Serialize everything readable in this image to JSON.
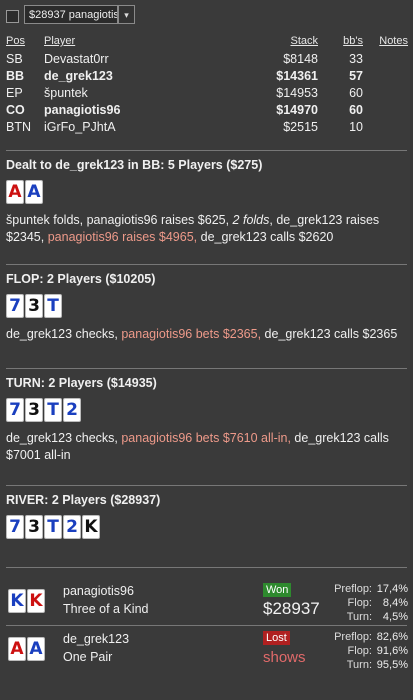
{
  "toolbar": {
    "selector_value": "$28937 panagiotis9",
    "arrow": "▾"
  },
  "table": {
    "headers": {
      "pos": "Pos",
      "player": "Player",
      "stack": "Stack",
      "bbs": "bb's",
      "notes": "Notes"
    },
    "rows": [
      {
        "pos": "SB",
        "player": "Devastat0rr",
        "stack": "$8148",
        "bbs": "33",
        "bold": false
      },
      {
        "pos": "BB",
        "player": "de_grek123",
        "stack": "$14361",
        "bbs": "57",
        "bold": true
      },
      {
        "pos": "EP",
        "player": "špuntek",
        "stack": "$14953",
        "bbs": "60",
        "bold": false
      },
      {
        "pos": "CO",
        "player": "panagiotis96",
        "stack": "$14970",
        "bbs": "60",
        "bold": true
      },
      {
        "pos": "BTN",
        "player": "iGrFo_PJhtA",
        "stack": "$2515",
        "bbs": "10",
        "bold": false
      }
    ]
  },
  "preflop": {
    "title": "Dealt to de_grek123 in BB: 5 Players ($275)",
    "cards": [
      {
        "rank": "A",
        "color": "#cc1111"
      },
      {
        "rank": "A",
        "color": "#1a3fbf"
      }
    ],
    "action": [
      {
        "text": "špuntek folds, panagiotis96 raises $625, ",
        "style": "n"
      },
      {
        "text": "2 folds",
        "style": "i"
      },
      {
        "text": ", de_grek123 raises $2345, ",
        "style": "n"
      },
      {
        "text": "panagiotis96 raises $4965,",
        "style": "h"
      },
      {
        "text": " de_grek123 calls $2620",
        "style": "n"
      }
    ]
  },
  "flop": {
    "title": "FLOP: 2 Players ($10205)",
    "cards": [
      {
        "rank": "7",
        "color": "#1a3fbf"
      },
      {
        "rank": "3",
        "color": "#111111"
      },
      {
        "rank": "T",
        "color": "#1a3fbf"
      }
    ],
    "action": [
      {
        "text": "de_grek123 checks, ",
        "style": "n"
      },
      {
        "text": "panagiotis96 bets $2365,",
        "style": "h"
      },
      {
        "text": " de_grek123 calls $2365",
        "style": "n"
      }
    ]
  },
  "turn": {
    "title": "TURN: 2 Players ($14935)",
    "cards": [
      {
        "rank": "7",
        "color": "#1a3fbf"
      },
      {
        "rank": "3",
        "color": "#111111"
      },
      {
        "rank": "T",
        "color": "#1a3fbf"
      },
      {
        "rank": "2",
        "color": "#1a3fbf"
      }
    ],
    "action": [
      {
        "text": "de_grek123 checks, ",
        "style": "n"
      },
      {
        "text": "panagiotis96 bets $7610 all-in,",
        "style": "h"
      },
      {
        "text": " de_grek123 calls $7001 all-in",
        "style": "n"
      }
    ]
  },
  "river": {
    "title": "RIVER: 2 Players ($28937)",
    "cards": [
      {
        "rank": "7",
        "color": "#1a3fbf"
      },
      {
        "rank": "3",
        "color": "#111111"
      },
      {
        "rank": "T",
        "color": "#1a3fbf"
      },
      {
        "rank": "2",
        "color": "#1a3fbf"
      },
      {
        "rank": "K",
        "color": "#111111"
      }
    ]
  },
  "results": [
    {
      "cards": [
        {
          "rank": "K",
          "color": "#1a3fbf"
        },
        {
          "rank": "K",
          "color": "#cc1111"
        }
      ],
      "name": "panagiotis96",
      "hand": "Three of a Kind",
      "badge": "Won",
      "amount": "$28937",
      "shows": "",
      "stats": [
        {
          "k": "Preflop:",
          "v": "17,4%"
        },
        {
          "k": "Flop:",
          "v": "8,4%"
        },
        {
          "k": "Turn:",
          "v": "4,5%"
        }
      ]
    },
    {
      "cards": [
        {
          "rank": "A",
          "color": "#cc1111"
        },
        {
          "rank": "A",
          "color": "#1a3fbf"
        }
      ],
      "name": "de_grek123",
      "hand": "One Pair",
      "badge": "Lost",
      "amount": "",
      "shows": "shows",
      "stats": [
        {
          "k": "Preflop:",
          "v": "82,6%"
        },
        {
          "k": "Flop:",
          "v": "91,6%"
        },
        {
          "k": "Turn:",
          "v": "95,5%"
        }
      ]
    }
  ]
}
